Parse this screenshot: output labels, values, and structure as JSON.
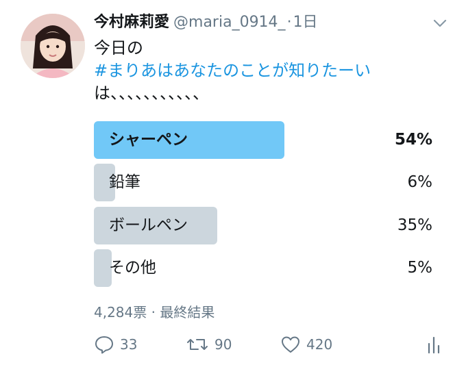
{
  "tweet": {
    "display_name": "今村麻莉愛",
    "handle": "@maria_0914_",
    "separator": "·",
    "time": "1日",
    "text_line1": "今日の",
    "hashtag": "#まりあはあなたのことが知りたーい",
    "text_line3": "は、、、、、、、、、、、"
  },
  "poll": {
    "options": [
      {
        "label": "シャーペン",
        "percent_text": "54%",
        "percent": 54,
        "winner": true
      },
      {
        "label": "鉛筆",
        "percent_text": "6%",
        "percent": 6,
        "winner": false
      },
      {
        "label": "ボールペン",
        "percent_text": "35%",
        "percent": 35,
        "winner": false
      },
      {
        "label": "その他",
        "percent_text": "5%",
        "percent": 5,
        "winner": false
      }
    ],
    "meta": "4,284票 · 最終結果"
  },
  "actions": {
    "replies": "33",
    "retweets": "90",
    "likes": "420"
  },
  "colors": {
    "winner_bar": "#71c8f7",
    "other_bar": "#ccd6dd",
    "hashtag": "#1b95e0",
    "muted": "#657786"
  },
  "icons": {
    "reply": "reply-icon",
    "retweet": "retweet-icon",
    "like": "heart-icon",
    "stats": "analytics-icon",
    "caret": "chevron-down-icon"
  }
}
